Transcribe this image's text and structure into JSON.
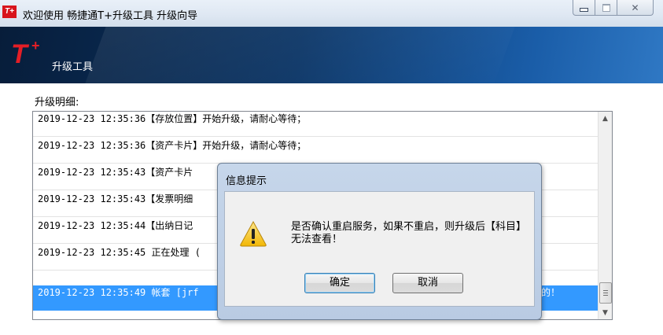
{
  "window": {
    "title": "欢迎使用  畅捷通T+升级工具  升级向导",
    "icon": "tplus-app-icon"
  },
  "banner": {
    "logo": "T+",
    "title": "升级工具"
  },
  "section": {
    "label": "升级明细:"
  },
  "log": [
    "2019-12-23  12:35:36【存放位置】开始升级，请耐心等待；",
    "2019-12-23  12:35:36【资产卡片】开始升级，请耐心等待；",
    "2019-12-23  12:35:43【资产卡片",
    "2019-12-23  12:35:43【发票明细",
    "2019-12-23  12:35:44【出纳日记",
    "2019-12-23  12:35:45 正在处理 (",
    "2019-12-23  12:35:49 帐套 [jrf"
  ],
  "selected_log_tail": "的！",
  "dialog": {
    "title": "信息提示",
    "message": "是否确认重启服务，如果不重启，则升级后【科目】无法查看！",
    "ok_label": "确定",
    "cancel_label": "取消",
    "icon": "warning-icon"
  },
  "colors": {
    "selection": "#3399ff",
    "logo_red": "#e41e26",
    "banner_dark": "#0b3566"
  }
}
